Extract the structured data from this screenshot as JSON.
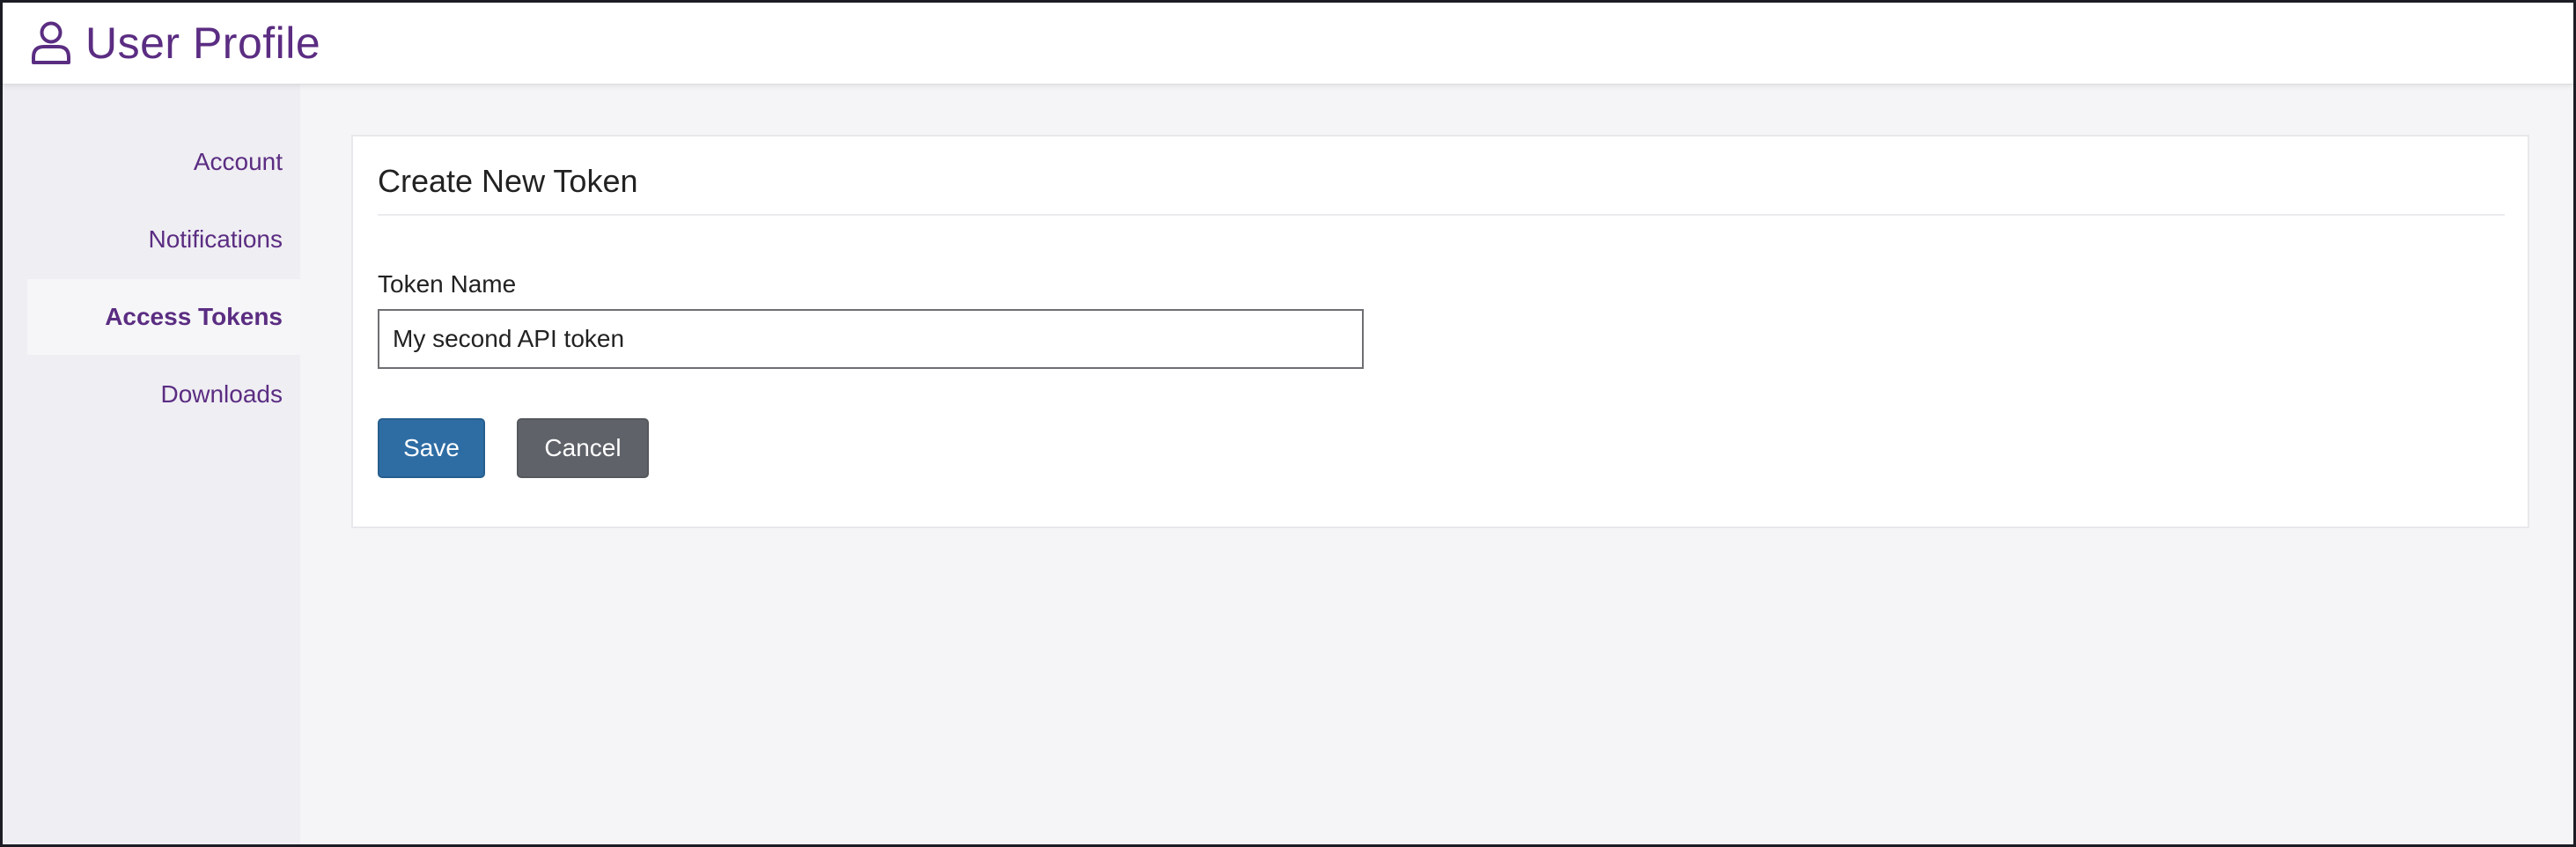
{
  "header": {
    "title": "User Profile",
    "icon": "user-icon",
    "accent_color": "#5b2d82"
  },
  "sidebar": {
    "items": [
      {
        "label": "Account",
        "active": false
      },
      {
        "label": "Notifications",
        "active": false
      },
      {
        "label": "Access Tokens",
        "active": true
      },
      {
        "label": "Downloads",
        "active": false
      }
    ]
  },
  "form": {
    "title": "Create New Token",
    "token_name_label": "Token Name",
    "token_name_value": "My second API token",
    "save_label": "Save",
    "cancel_label": "Cancel",
    "save_color": "#2e6da4",
    "cancel_color": "#5f6268"
  }
}
